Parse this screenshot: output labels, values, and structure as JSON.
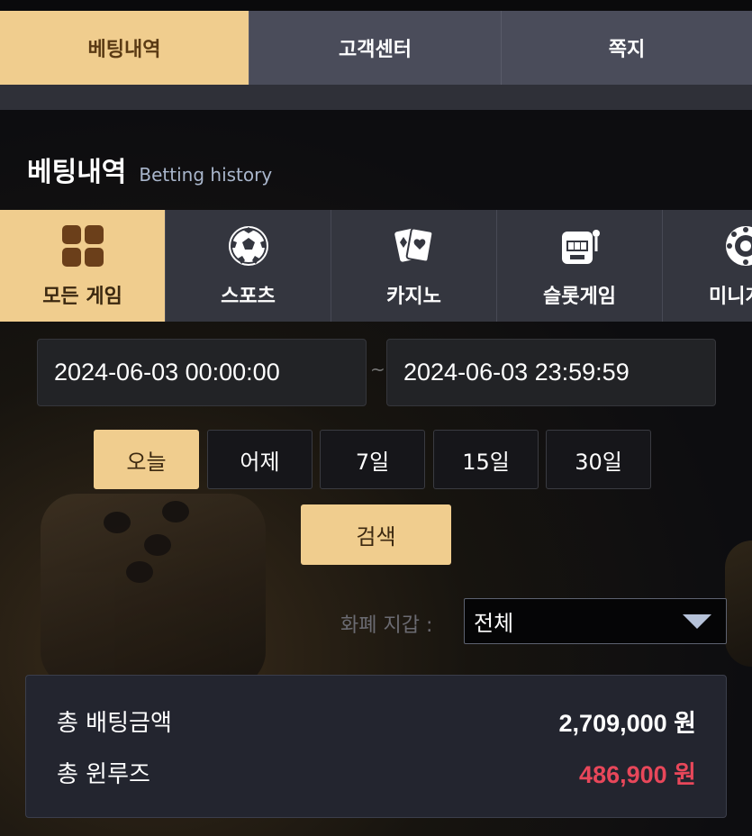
{
  "top_tabs": [
    {
      "label": "베팅내역",
      "active": true
    },
    {
      "label": "고객센터",
      "active": false
    },
    {
      "label": "쪽지",
      "active": false
    }
  ],
  "section": {
    "title": "베팅내역",
    "subtitle": "Betting history"
  },
  "game_tabs": [
    {
      "label": "모든 게임",
      "icon": "grid-icon",
      "active": true
    },
    {
      "label": "스포츠",
      "icon": "soccer-ball-icon",
      "active": false
    },
    {
      "label": "카지노",
      "icon": "cards-icon",
      "active": false
    },
    {
      "label": "슬롯게임",
      "icon": "slot-machine-icon",
      "active": false
    },
    {
      "label": "미니게임",
      "icon": "roulette-icon",
      "active": false
    }
  ],
  "date_range": {
    "start": "2024-06-03 00:00:00",
    "separator": "~",
    "end": "2024-06-03 23:59:59"
  },
  "periods": [
    {
      "label": "오늘",
      "active": true
    },
    {
      "label": "어제",
      "active": false
    },
    {
      "label": "7일",
      "active": false
    },
    {
      "label": "15일",
      "active": false
    },
    {
      "label": "30일",
      "active": false
    }
  ],
  "search_label": "검색",
  "wallet": {
    "label": "화폐 지갑 :",
    "selected": "전체"
  },
  "summary": {
    "total_bet_label": "총 배팅금액",
    "total_bet_value": "2,709,000 원",
    "total_winloss_label": "총 윈루즈",
    "total_winloss_value": "486,900 원"
  },
  "colors": {
    "accent": "#f0cd8e",
    "tab_bg": "#4a4c5a",
    "loss_red": "#e8475a"
  }
}
